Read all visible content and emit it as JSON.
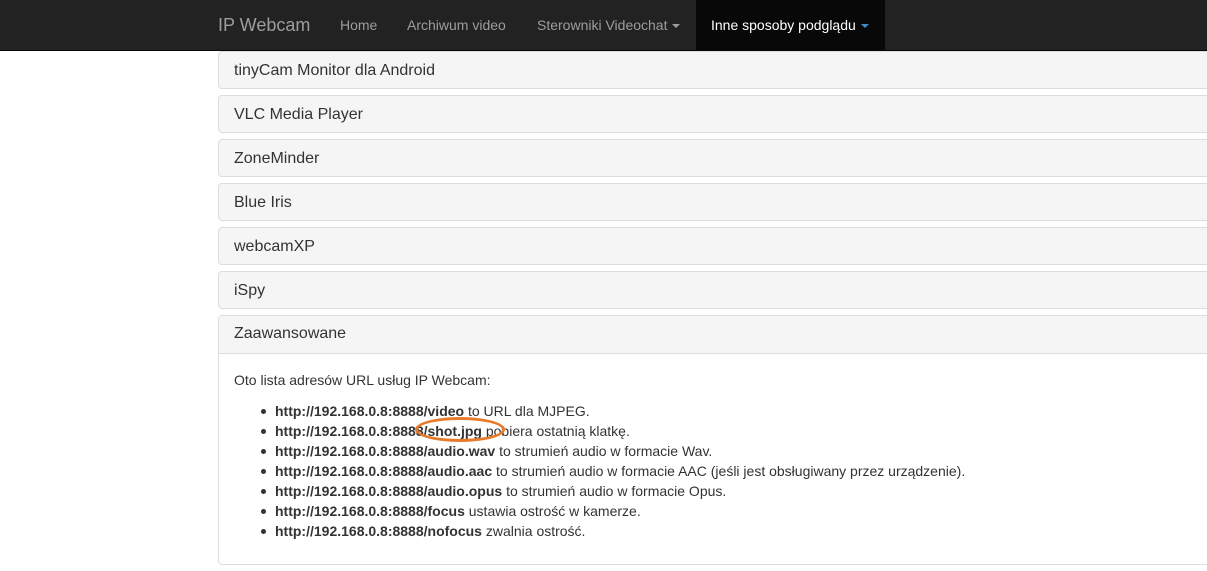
{
  "navbar": {
    "brand": "IP Webcam",
    "items": [
      {
        "label": "Home"
      },
      {
        "label": "Archiwum video"
      },
      {
        "label": "Sterowniki Videochat"
      },
      {
        "label": "Inne sposoby podglądu"
      }
    ]
  },
  "panels": [
    {
      "title": "tinyCam Monitor dla Android"
    },
    {
      "title": "VLC Media Player"
    },
    {
      "title": "ZoneMinder"
    },
    {
      "title": "Blue Iris"
    },
    {
      "title": "webcamXP"
    },
    {
      "title": "iSpy"
    }
  ],
  "advanced": {
    "title": "Zaawansowane",
    "intro": "Oto lista adresów URL usług IP Webcam:",
    "urls": [
      {
        "url": "http://192.168.0.8:8888/video",
        "desc": " to URL dla MJPEG."
      },
      {
        "url": "http://192.168.0.8:8888/shot.jpg",
        "desc": " pobiera ostatnią klatkę."
      },
      {
        "url": "http://192.168.0.8:8888/audio.wav",
        "desc": " to strumień audio w formacie Wav."
      },
      {
        "url": "http://192.168.0.8:8888/audio.aac",
        "desc": " to strumień audio w formacie AAC (jeśli jest obsługiwany przez urządzenie)."
      },
      {
        "url": "http://192.168.0.8:8888/audio.opus",
        "desc": " to strumień audio w formacie Opus."
      },
      {
        "url": "http://192.168.0.8:8888/focus",
        "desc": " ustawia ostrość w kamerze."
      },
      {
        "url": "http://192.168.0.8:8888/nofocus",
        "desc": " zwalnia ostrość."
      }
    ]
  },
  "colors": {
    "navbar_bg": "#222222",
    "active_bg": "#080808",
    "caret_active": "#428bca",
    "annotation": "#e87a2b"
  }
}
